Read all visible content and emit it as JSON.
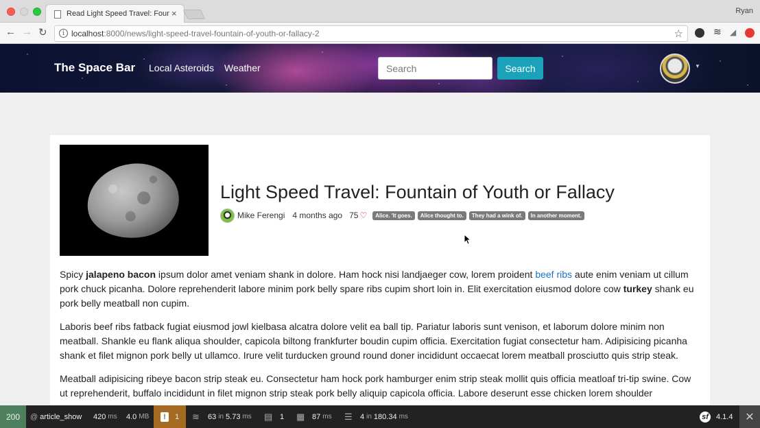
{
  "browser": {
    "tab_title": "Read Light Speed Travel: Fountain of Youth or Fallacy",
    "tab_close": "×",
    "profile_name": "Ryan",
    "url_host": "localhost",
    "url_path": ":8000/news/light-speed-travel-fountain-of-youth-or-fallacy-2",
    "back_glyph": "←",
    "forward_glyph": "→",
    "reload_glyph": "↻",
    "info_glyph": "i",
    "star_glyph": "☆"
  },
  "header": {
    "brand": "The Space Bar",
    "nav": [
      {
        "label": "Local Asteroids"
      },
      {
        "label": "Weather"
      }
    ],
    "search_placeholder": "Search",
    "search_button": "Search",
    "avatar_caret": "▼"
  },
  "article": {
    "title": "Light Speed Travel: Fountain of Youth or Fallacy",
    "author": "Mike Ferengi",
    "published": "4 months ago",
    "heart_count": "75",
    "heart_glyph": "♡",
    "tags": [
      "Alice. 'It goes.",
      "Alice thought to.",
      "They had a wink of.",
      "In another moment."
    ],
    "p1": {
      "t1": "Spicy ",
      "b1": "jalapeno bacon",
      "t2": " ipsum dolor amet veniam shank in dolore. Ham hock nisi landjaeger cow, lorem proident ",
      "link": "beef ribs",
      "t3": " aute enim veniam ut cillum pork chuck picanha. Dolore reprehenderit labore minim pork belly spare ribs cupim short loin in. Elit exercitation eiusmod dolore cow ",
      "b2": "turkey",
      "t4": " shank eu pork belly meatball non cupim."
    },
    "p2": "Laboris beef ribs fatback fugiat eiusmod jowl kielbasa alcatra dolore velit ea ball tip. Pariatur laboris sunt venison, et laborum dolore minim non meatball. Shankle eu flank aliqua shoulder, capicola biltong frankfurter boudin cupim officia. Exercitation fugiat consectetur ham. Adipisicing picanha shank et filet mignon pork belly ut ullamco. Irure velit turducken ground round doner incididunt occaecat lorem meatball prosciutto quis strip steak.",
    "p3": "Meatball adipisicing ribeye bacon strip steak eu. Consectetur ham hock pork hamburger enim strip steak mollit quis officia meatloaf tri-tip swine. Cow ut reprehenderit, buffalo incididunt in filet mignon strip steak pork belly aliquip capicola officia. Labore deserunt esse chicken lorem shoulder"
  },
  "profiler": {
    "status": "200",
    "route_at": "@",
    "route": "article_show",
    "time_value": "420",
    "time_unit": "ms",
    "memory_value": "4.0",
    "memory_unit": "MB",
    "warn_glyph": "!",
    "warnings": "1",
    "forms_count": "63",
    "forms_in": "in",
    "forms_time": "5.73",
    "forms_unit": "ms",
    "translations": "1",
    "twig_time": "87",
    "twig_unit": "ms",
    "db_count": "4",
    "db_in": "in",
    "db_time": "180.34",
    "db_unit": "ms",
    "sf_logo": "sf",
    "version": "4.1.4",
    "close_glyph": "✕"
  },
  "colors": {
    "search_button": "#1aa2bb",
    "status_ok": "#4f805d",
    "warning": "#a46a1f",
    "link": "#1a73c8",
    "tag": "#7a7a7a",
    "heart": "#d0021b"
  }
}
